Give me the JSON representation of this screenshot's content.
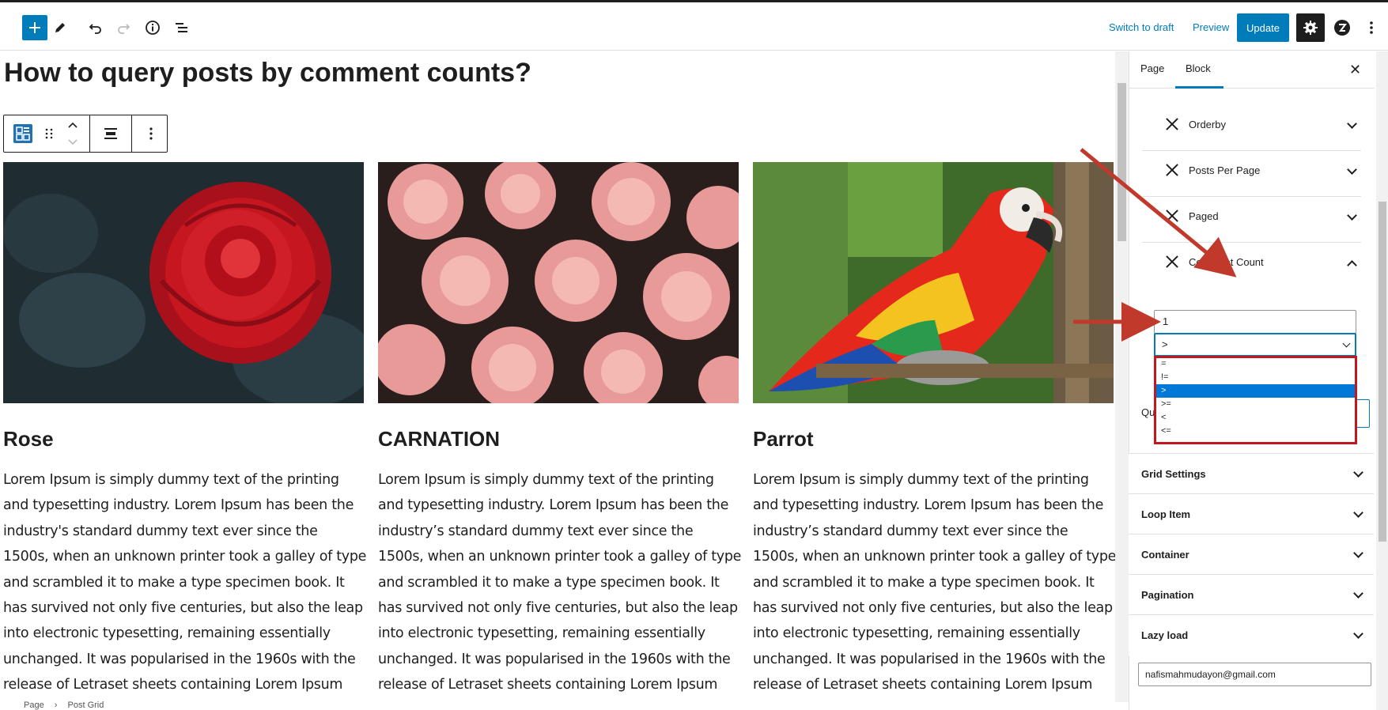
{
  "topbar": {
    "switch_to_draft": "Switch to draft",
    "preview": "Preview",
    "update": "Update"
  },
  "editor": {
    "title": "How to query posts by comment counts?",
    "posts": [
      {
        "title": "Rose",
        "text": "Lorem Ipsum is simply dummy text of the printing and typesetting industry. Lorem Ipsum has been the industry's standard dummy text ever since the 1500s, when an unknown printer took a galley of type and scrambled it to make a type specimen book. It has survived not only five centuries, but also the leap into electronic typesetting, remaining essentially unchanged. It was popularised in the 1960s with the release of Letraset sheets containing Lorem Ipsum passages, and"
      },
      {
        "title": "CARNATION",
        "text": "Lorem Ipsum is simply dummy text of the printing and typesetting industry. Lorem Ipsum has been the industry’s standard dummy text ever since the 1500s, when an unknown printer took a galley of type and scrambled it to make a type specimen book. It has survived not only five centuries, but also the leap into electronic typesetting, remaining essentially unchanged. It was popularised in the 1960s with the release of Letraset sheets containing Lorem Ipsum passages, and"
      },
      {
        "title": "Parrot",
        "text": "Lorem Ipsum is simply dummy text of the printing and typesetting industry. Lorem Ipsum has been the industry’s standard dummy text ever since the 1500s, when an unknown printer took a galley of type and scrambled it to make a type specimen book. It has survived not only five centuries, but also the leap into electronic typesetting, remaining essentially unchanged. It was popularised in the 1960s with the release of Letraset sheets containing Lorem Ipsum passages, and"
      }
    ],
    "breadcrumb": [
      "Page",
      "Post Grid"
    ]
  },
  "sidebar": {
    "tabs": [
      "Page",
      "Block"
    ],
    "query_rows": [
      "Orderby",
      "Posts Per Page",
      "Paged",
      "Comment Count"
    ],
    "comment_count": {
      "value": "1",
      "compare_selected": ">",
      "compare_options": [
        "=",
        "!=",
        ">",
        ">=",
        "<",
        "<="
      ]
    },
    "partial_label": "Qu",
    "panels": [
      "Grid Settings",
      "Loop Item",
      "Container",
      "Pagination",
      "Lazy load"
    ],
    "email": "nafismahmudayon@gmail.com"
  },
  "colors": {
    "accent": "#007cba",
    "annotation": "#c0392b",
    "highlight_border": "#c0181c",
    "selected_option": "#0078d7"
  }
}
